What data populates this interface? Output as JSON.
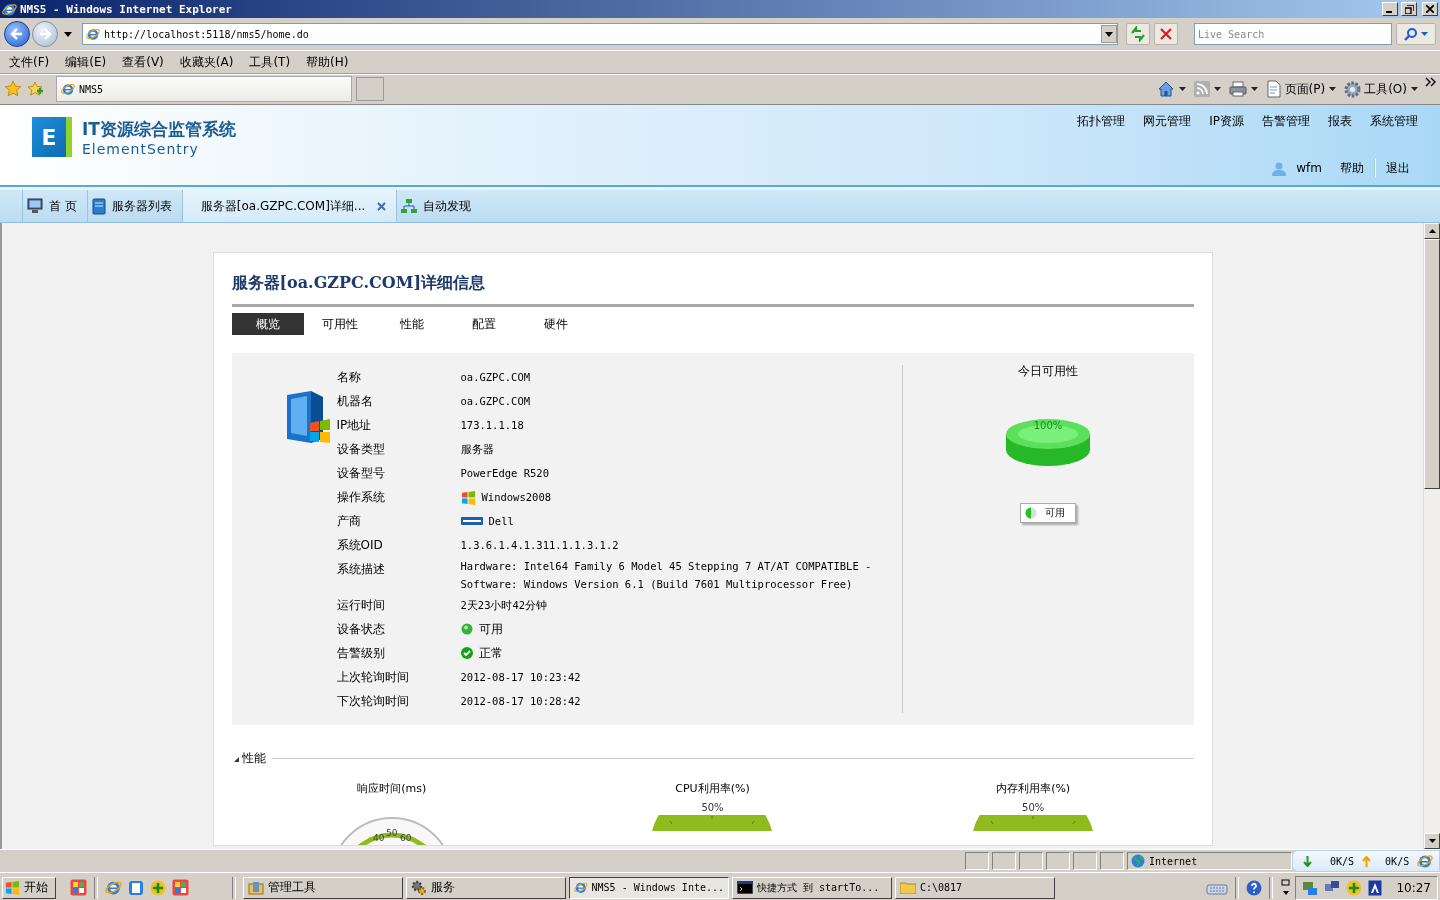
{
  "window": {
    "title": "NMS5 - Windows Internet Explorer"
  },
  "address_bar": {
    "url": "http://localhost:5118/nms5/home.do"
  },
  "search": {
    "placeholder": "Live Search"
  },
  "menu": [
    "文件(F)",
    "编辑(E)",
    "查看(V)",
    "收藏夹(A)",
    "工具(T)",
    "帮助(H)"
  ],
  "browser_tabs": [
    {
      "label": "NMS5",
      "selected": true
    }
  ],
  "command_bar": [
    {
      "kind": "home"
    },
    {
      "kind": "feed"
    },
    {
      "kind": "print"
    },
    {
      "kind": "page",
      "label": "页面(P)"
    },
    {
      "kind": "tools",
      "label": "工具(O)"
    }
  ],
  "app": {
    "logo_letter": "E",
    "title": "IT资源综合监管系统",
    "subtitle": "ElementSentry",
    "nav": [
      "拓扑管理",
      "网元管理",
      "IP资源",
      "告警管理",
      "报表",
      "系统管理"
    ],
    "user": "wfm",
    "links": [
      "帮助",
      "退出"
    ]
  },
  "page_tabs": [
    {
      "label": "首 页",
      "kind": "monitor",
      "selected": false,
      "closable": false
    },
    {
      "label": "服务器列表",
      "kind": "server",
      "selected": false,
      "closable": false
    },
    {
      "label": "服务器[oa.GZPC.COM]详细...",
      "kind": "none",
      "selected": true,
      "closable": true
    },
    {
      "label": "自动发现",
      "kind": "network",
      "selected": false,
      "closable": false
    }
  ],
  "detail": {
    "title": "服务器[oa.GZPC.COM]详细信息",
    "tabs": [
      {
        "label": "概览",
        "selected": true
      },
      {
        "label": "可用性",
        "selected": false
      },
      {
        "label": "性能",
        "selected": false
      },
      {
        "label": "配置",
        "selected": false
      },
      {
        "label": "硬件",
        "selected": false
      }
    ],
    "fields": [
      {
        "label": "名称",
        "value": "oa.GZPC.COM",
        "kind": "text"
      },
      {
        "label": "机器名",
        "value": "oa.GZPC.COM",
        "kind": "text"
      },
      {
        "label": "IP地址",
        "value": "173.1.1.18",
        "kind": "text"
      },
      {
        "label": "设备类型",
        "value": "服务器",
        "kind": "text"
      },
      {
        "label": "设备型号",
        "value": "PowerEdge R520",
        "kind": "text"
      },
      {
        "label": "操作系统",
        "value": "Windows2008",
        "kind": "os"
      },
      {
        "label": "产商",
        "value": "Dell",
        "kind": "vendor"
      },
      {
        "label": "系统OID",
        "value": "1.3.6.1.4.1.311.1.1.3.1.2",
        "kind": "text"
      },
      {
        "label": "系统描述",
        "value": "Hardware: Intel64 Family 6 Model 45 Stepping 7 AT/AT COMPATIBLE - Software: Windows Version 6.1 (Build 7601 Multiprocessor Free)",
        "kind": "text"
      },
      {
        "label": "运行时间",
        "value": "2天23小时42分钟",
        "kind": "text"
      },
      {
        "label": "设备状态",
        "value": "可用",
        "kind": "status"
      },
      {
        "label": "告警级别",
        "value": "正常",
        "kind": "alarm"
      },
      {
        "label": "上次轮询时间",
        "value": "2012-08-17 10:23:42",
        "kind": "text"
      },
      {
        "label": "下次轮询时间",
        "value": "2012-08-17 10:28:42",
        "kind": "text"
      }
    ]
  },
  "availability": {
    "title": "今日可用性",
    "pie_label": "100%",
    "legend": [
      {
        "label": "可用",
        "color": "#22c322"
      }
    ]
  },
  "performance": {
    "title": "性能",
    "expanded": true,
    "gauges": [
      {
        "title": "响应时间(ms)",
        "kind": "dial",
        "ticks": [
          "40",
          "50",
          "60"
        ]
      },
      {
        "title": "CPU利用率(%)",
        "kind": "arc",
        "reading": "50%"
      },
      {
        "title": "内存利用率(%)",
        "kind": "arc",
        "reading": "50%"
      }
    ]
  },
  "status_bar": {
    "zone": "Internet"
  },
  "net_speed": {
    "down": "0K/S",
    "up": "0K/S"
  },
  "taskbar": {
    "start": "开始",
    "tasks": [
      {
        "label": "管理工具",
        "kind": "tools",
        "selected": false
      },
      {
        "label": "服务",
        "kind": "gears",
        "selected": false
      },
      {
        "label": "NMS5 - Windows Inte...",
        "kind": "ie",
        "selected": true
      },
      {
        "label": "快捷方式 到 startTo...",
        "kind": "console",
        "selected": false
      },
      {
        "label": "C:\\0817",
        "kind": "folder",
        "selected": false
      }
    ],
    "clock": "10:27"
  }
}
